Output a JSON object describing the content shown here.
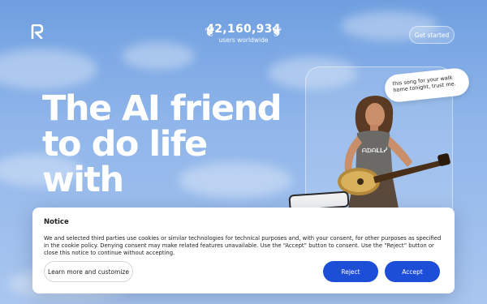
{
  "header": {
    "logo_name": "replika-logo",
    "counter_value": "42,160,934",
    "counter_label": "users worldwide",
    "cta_label": "Get started"
  },
  "hero": {
    "headline_lines": [
      "The AI friend",
      "to do life",
      "with"
    ],
    "speech_bubble": "this song for your walk home tonight, trust me."
  },
  "consent": {
    "title": "Notice",
    "body": "We and selected third parties use cookies or similar technologies for technical purposes and, with your consent, for other purposes as specified in the cookie policy. Denying consent may make related features unavailable. Use the “Accept” button to consent. Use the “Reject” button or close this notice to continue without accepting.",
    "learn_more_label": "Learn more and customize",
    "reject_label": "Reject",
    "accept_label": "Accept"
  },
  "colors": {
    "sky_top": "#6f9fe0",
    "sky_bottom": "#a9c6ef",
    "primary_button": "#1d4ed8"
  }
}
